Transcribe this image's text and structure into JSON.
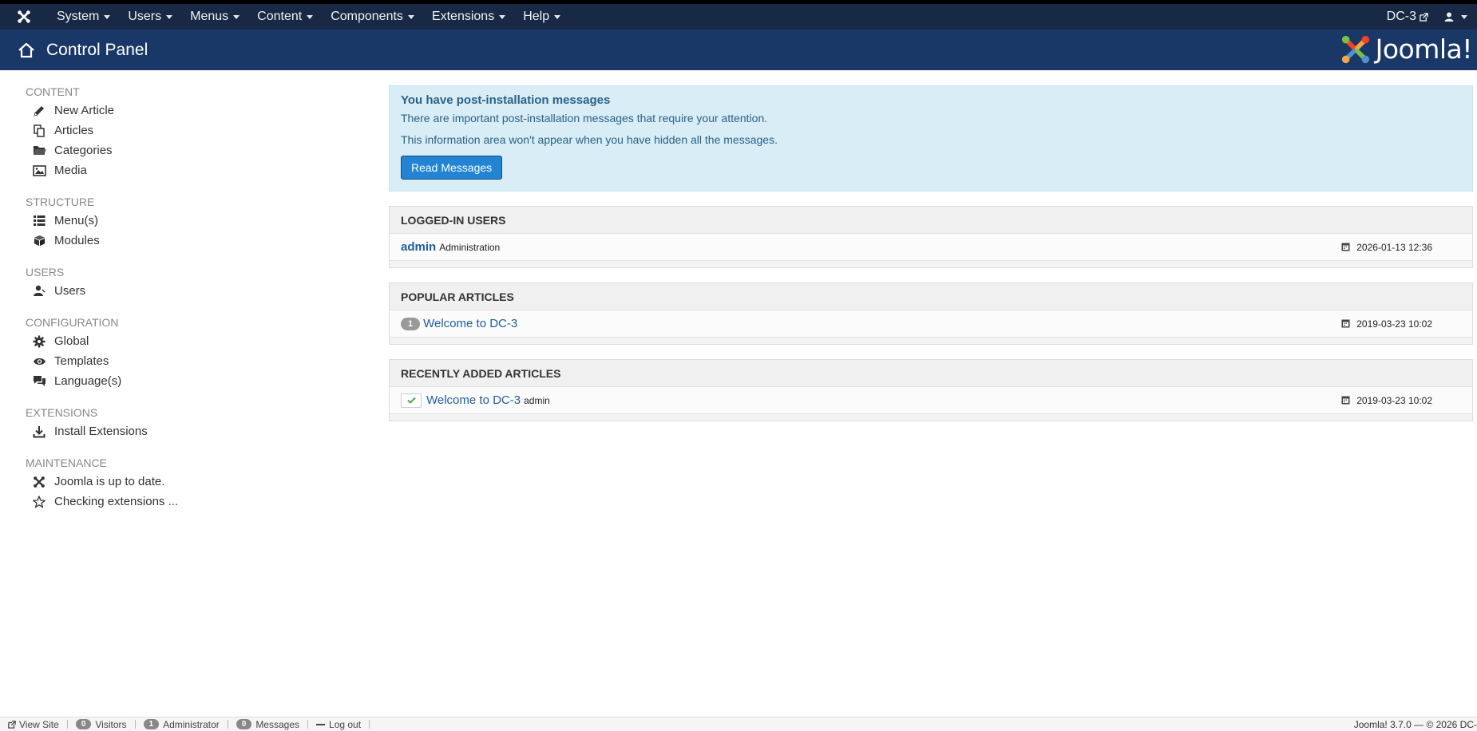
{
  "navbar": {
    "menus": [
      {
        "label": "System"
      },
      {
        "label": "Users"
      },
      {
        "label": "Menus"
      },
      {
        "label": "Content"
      },
      {
        "label": "Components"
      },
      {
        "label": "Extensions"
      },
      {
        "label": "Help"
      }
    ],
    "site_label": "DC-3"
  },
  "header": {
    "title": "Control Panel",
    "brand": "Joomla!"
  },
  "sidebar": {
    "groups": [
      {
        "heading": "CONTENT",
        "items": [
          {
            "label": "New Article",
            "icon": "pencil-icon"
          },
          {
            "label": "Articles",
            "icon": "copy-icon"
          },
          {
            "label": "Categories",
            "icon": "folder-icon"
          },
          {
            "label": "Media",
            "icon": "picture-icon"
          }
        ]
      },
      {
        "heading": "STRUCTURE",
        "items": [
          {
            "label": "Menu(s)",
            "icon": "list-icon"
          },
          {
            "label": "Modules",
            "icon": "cube-icon"
          }
        ]
      },
      {
        "heading": "USERS",
        "items": [
          {
            "label": "Users",
            "icon": "user-icon"
          }
        ]
      },
      {
        "heading": "CONFIGURATION",
        "items": [
          {
            "label": "Global",
            "icon": "gear-icon"
          },
          {
            "label": "Templates",
            "icon": "eye-icon"
          },
          {
            "label": "Language(s)",
            "icon": "comments-icon"
          }
        ]
      },
      {
        "heading": "EXTENSIONS",
        "items": [
          {
            "label": "Install Extensions",
            "icon": "download-icon"
          }
        ]
      },
      {
        "heading": "MAINTENANCE",
        "items": [
          {
            "label": "Joomla is up to date.",
            "icon": "joomla-icon"
          },
          {
            "label": "Checking extensions ...",
            "icon": "star-icon"
          }
        ]
      }
    ]
  },
  "alert": {
    "title": "You have post-installation messages",
    "line1": "There are important post-installation messages that require your attention.",
    "line2": "This information area won't appear when you have hidden all the messages.",
    "button": "Read Messages"
  },
  "logged_in": {
    "heading": "LOGGED-IN USERS",
    "rows": [
      {
        "name": "admin",
        "role": "Administration",
        "date": "2026-01-13 12:36"
      }
    ]
  },
  "popular": {
    "heading": "POPULAR ARTICLES",
    "rows": [
      {
        "hits": "1",
        "title": "Welcome to DC-3",
        "date": "2019-03-23 10:02"
      }
    ]
  },
  "recent": {
    "heading": "RECENTLY ADDED ARTICLES",
    "rows": [
      {
        "title": "Welcome to DC-3",
        "author": "admin",
        "date": "2019-03-23 10:02"
      }
    ]
  },
  "statusbar": {
    "view_site": "View Site",
    "visitors_count": "0",
    "visitors_label": "Visitors",
    "admin_count": "1",
    "admin_label": "Administrator",
    "messages_count": "0",
    "messages_label": "Messages",
    "logout": "Log out",
    "copyright": "Joomla! 3.7.0 — © 2026 DC-"
  },
  "colors": {
    "navbar": "#172944",
    "header": "#1a3867",
    "link": "#1f5c9e",
    "alert_bg": "#d9edf7",
    "button": "#2384d3"
  }
}
